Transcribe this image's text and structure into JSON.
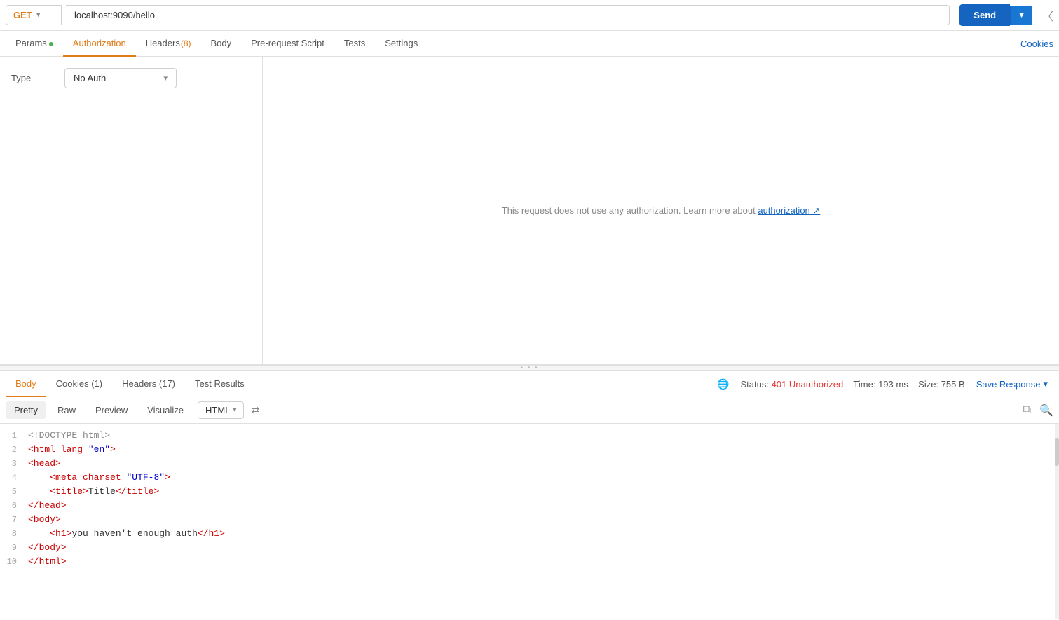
{
  "topbar": {
    "method": "GET",
    "method_chevron": "▼",
    "url": "localhost:9090/hello",
    "send_label": "Send",
    "send_chevron": "▼"
  },
  "request_tabs": {
    "params_label": "Params",
    "params_dot": true,
    "authorization_label": "Authorization",
    "headers_label": "Headers",
    "headers_count": "(8)",
    "body_label": "Body",
    "prerequest_label": "Pre-request Script",
    "tests_label": "Tests",
    "settings_label": "Settings",
    "cookies_label": "Cookies"
  },
  "auth_panel": {
    "type_label": "Type",
    "type_value": "No Auth",
    "type_chevron": "▾",
    "no_auth_message": "This request does not use any authorization. Learn more about ",
    "auth_link": "authorization",
    "auth_link_arrow": " ↗"
  },
  "response_tabs": {
    "body_label": "Body",
    "cookies_label": "Cookies (1)",
    "headers_label": "Headers (17)",
    "test_results_label": "Test Results",
    "status_label": "Status:",
    "status_code": "401 Unauthorized",
    "time_label": "Time:",
    "time_value": "193 ms",
    "size_label": "Size:",
    "size_value": "755 B",
    "save_response_label": "Save Response",
    "save_chevron": "▾"
  },
  "format_bar": {
    "pretty_label": "Pretty",
    "raw_label": "Raw",
    "preview_label": "Preview",
    "visualize_label": "Visualize",
    "format_value": "HTML",
    "format_chevron": "▾"
  },
  "code_lines": [
    {
      "num": 1,
      "content": [
        {
          "type": "doctype",
          "text": "<!DOCTYPE html>"
        }
      ]
    },
    {
      "num": 2,
      "content": [
        {
          "type": "tag",
          "text": "<html"
        },
        {
          "type": "attr-name",
          "text": " lang"
        },
        {
          "type": "text",
          "text": "="
        },
        {
          "type": "attr-val",
          "text": "\"en\""
        },
        {
          "type": "tag",
          "text": ">"
        }
      ]
    },
    {
      "num": 3,
      "content": [
        {
          "type": "tag",
          "text": "<head>"
        }
      ]
    },
    {
      "num": 4,
      "content": [
        {
          "type": "text",
          "text": "    "
        },
        {
          "type": "tag",
          "text": "<meta"
        },
        {
          "type": "attr-name",
          "text": " charset"
        },
        {
          "type": "text",
          "text": "="
        },
        {
          "type": "attr-val",
          "text": "\"UTF-8\""
        },
        {
          "type": "tag",
          "text": ">"
        }
      ]
    },
    {
      "num": 5,
      "content": [
        {
          "type": "text",
          "text": "    "
        },
        {
          "type": "tag",
          "text": "<title>"
        },
        {
          "type": "text",
          "text": "Title"
        },
        {
          "type": "tag",
          "text": "</title>"
        }
      ]
    },
    {
      "num": 6,
      "content": [
        {
          "type": "tag",
          "text": "</head>"
        }
      ]
    },
    {
      "num": 7,
      "content": [
        {
          "type": "tag",
          "text": "<body>"
        }
      ]
    },
    {
      "num": 8,
      "content": [
        {
          "type": "text",
          "text": "    "
        },
        {
          "type": "tag",
          "text": "<h1>"
        },
        {
          "type": "text",
          "text": "you haven't enough auth"
        },
        {
          "type": "tag",
          "text": "</h1>"
        }
      ]
    },
    {
      "num": 9,
      "content": [
        {
          "type": "tag",
          "text": "</body>"
        }
      ]
    },
    {
      "num": 10,
      "content": [
        {
          "type": "tag",
          "text": "</html>"
        }
      ]
    }
  ]
}
